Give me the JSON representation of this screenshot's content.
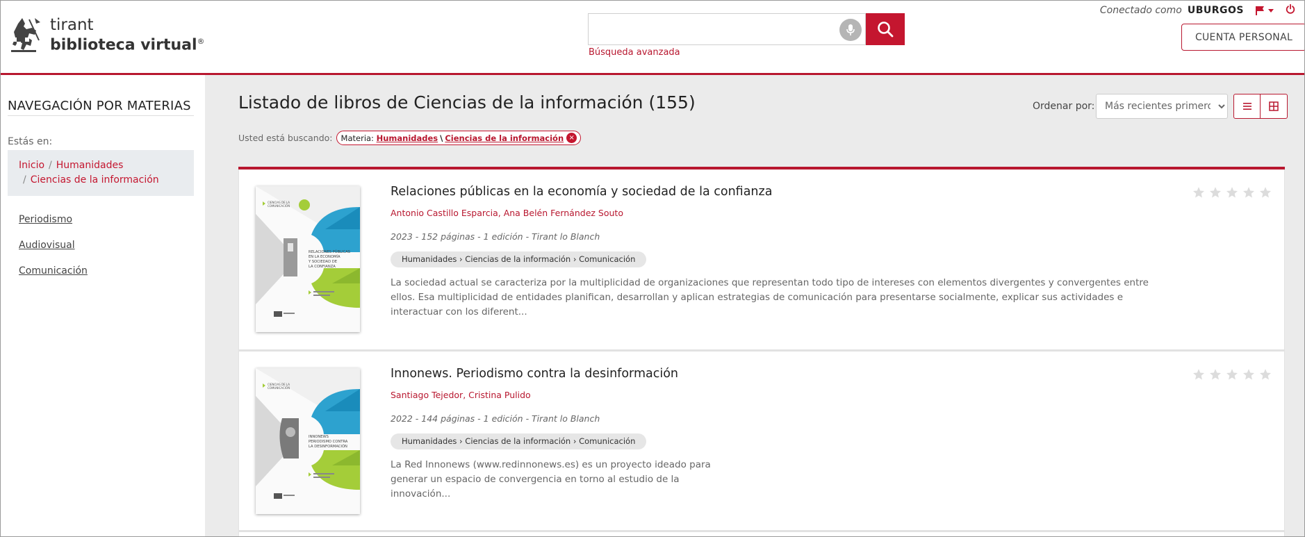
{
  "header": {
    "logo_line1": "tirant",
    "logo_line2": "biblioteca virtual",
    "logo_reg": "®",
    "search_placeholder": "",
    "advanced_search": "Búsqueda avanzada",
    "connected_as": "Conectado como",
    "username": "UBURGOS",
    "account_button": "CUENTA PERSONAL",
    "icons": [
      "knight-logo",
      "microphone-icon",
      "search-icon",
      "flag-icon",
      "caret-down-icon",
      "power-icon"
    ],
    "accent_color": "#c4162f"
  },
  "sidebar": {
    "title": "NAVEGACIÓN POR MATERIAS",
    "you_are_in": "Estás en:",
    "breadcrumb": {
      "home": "Inicio",
      "sep": "/",
      "level1": "Humanidades",
      "level2": "Ciencias de la información"
    },
    "links": [
      "Periodismo",
      "Audiovisual",
      "Comunicación"
    ]
  },
  "main": {
    "title": "Listado de libros de Ciencias de la información (155)",
    "order_label": "Ordenar por:",
    "order_selected": "Más recientes primero",
    "view_icons": [
      "list-view-icon",
      "grid-view-icon"
    ],
    "searching_label": "Usted está buscando:",
    "filter": {
      "prefix": "Materia:",
      "level1": "Humanidades",
      "sep": "\\",
      "level2": "Ciencias de la información",
      "close": "×"
    },
    "books": [
      {
        "title": "Relaciones públicas en la economía y sociedad de la confianza",
        "authors": "Antonio Castillo Esparcia, Ana Belén Fernández Souto",
        "meta": "2023 - 152 páginas - 1 edición - Tirant lo Blanch",
        "tags": "Humanidades › Ciencias de la información › Comunicación",
        "description": "La sociedad actual se caracteriza por la multiplicidad de organizaciones que representan todo tipo de intereses con elementos divergentes y convergentes entre ellos. Esa multiplicidad de entidades planifican, desarrollan y aplican estrategias de comunicación para presentarse socialmente, explicar sus actividades e interactuar con los diferent...",
        "rating": 0,
        "cover": {
          "series": "CIENCIAS DE LA COMUNICACIÓN",
          "title_lines": [
            "RELACIONES PÚBLICAS",
            "EN LA ECONOMÍA",
            "Y SOCIEDAD DE",
            "LA CONFIANZA"
          ]
        }
      },
      {
        "title": "Innonews. Periodismo contra la desinformación",
        "authors": "Santiago Tejedor, Cristina Pulido",
        "meta": "2022 - 144 páginas - 1 edición - Tirant lo Blanch",
        "tags": "Humanidades › Ciencias de la información › Comunicación",
        "description": "La Red Innonews (www.redinnonews.es) es un proyecto ideado para generar un espacio de convergencia en torno al estudio de la innovación...",
        "rating": 0,
        "cover": {
          "series": "CIENCIAS DE LA COMUNICACIÓN",
          "title_lines": [
            "INNONEWS",
            "PERIODISMO CONTRA",
            "LA DESINFORMACIÓN"
          ]
        }
      }
    ]
  }
}
